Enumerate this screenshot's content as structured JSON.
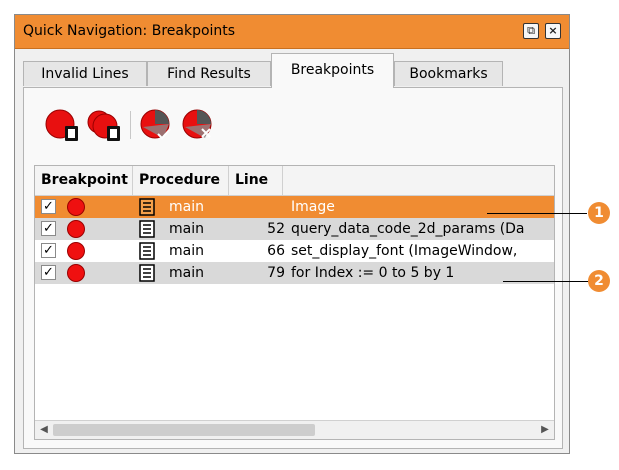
{
  "window": {
    "title": "Quick Navigation: Breakpoints",
    "float_icon": "float-icon",
    "close_icon": "close-icon"
  },
  "tabs": [
    {
      "label": "Invalid Lines"
    },
    {
      "label": "Find Results"
    },
    {
      "label": "Breakpoints",
      "active": true
    },
    {
      "label": "Bookmarks"
    }
  ],
  "toolbar": {
    "icons": [
      "activate-all-breakpoints-icon",
      "deactivate-all-breakpoints-icon",
      "enable-breakpoint-icon",
      "clear-breakpoint-icon"
    ]
  },
  "table": {
    "columns": [
      "Breakpoint",
      "Procedure",
      "Line"
    ],
    "rows": [
      {
        "checked": "✓",
        "procedure": "main",
        "line": "",
        "code": "Image",
        "selected": true
      },
      {
        "checked": "✓",
        "procedure": "main",
        "line": "52",
        "code": "query_data_code_2d_params (Da"
      },
      {
        "checked": "✓",
        "procedure": "main",
        "line": "66",
        "code": "set_display_font (ImageWindow,"
      },
      {
        "checked": "✓",
        "procedure": "main",
        "line": "79",
        "code": "for Index := 0 to 5 by 1"
      }
    ]
  },
  "scrollbar": {
    "left_arrow": "◀",
    "right_arrow": "▶"
  },
  "callouts": [
    "1",
    "2"
  ],
  "colors": {
    "accent": "#f08c32",
    "breakpoint": "#ef1010"
  }
}
